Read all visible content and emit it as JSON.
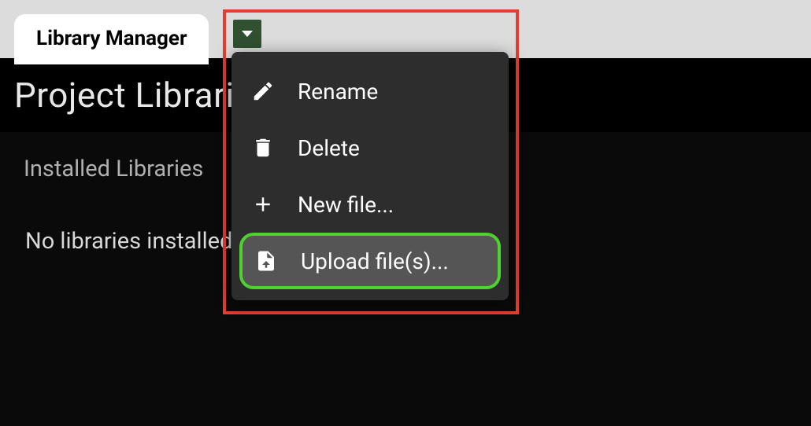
{
  "tab": {
    "label": "Library Manager"
  },
  "page": {
    "title": "Project Libraries"
  },
  "section": {
    "heading": "Installed Libraries",
    "empty_message": "No libraries installed."
  },
  "menu": {
    "items": [
      {
        "icon": "pencil-icon",
        "label": "Rename"
      },
      {
        "icon": "trash-icon",
        "label": "Delete"
      },
      {
        "icon": "plus-icon",
        "label": "New file..."
      },
      {
        "icon": "file-upload-icon",
        "label": "Upload file(s)..."
      }
    ]
  }
}
